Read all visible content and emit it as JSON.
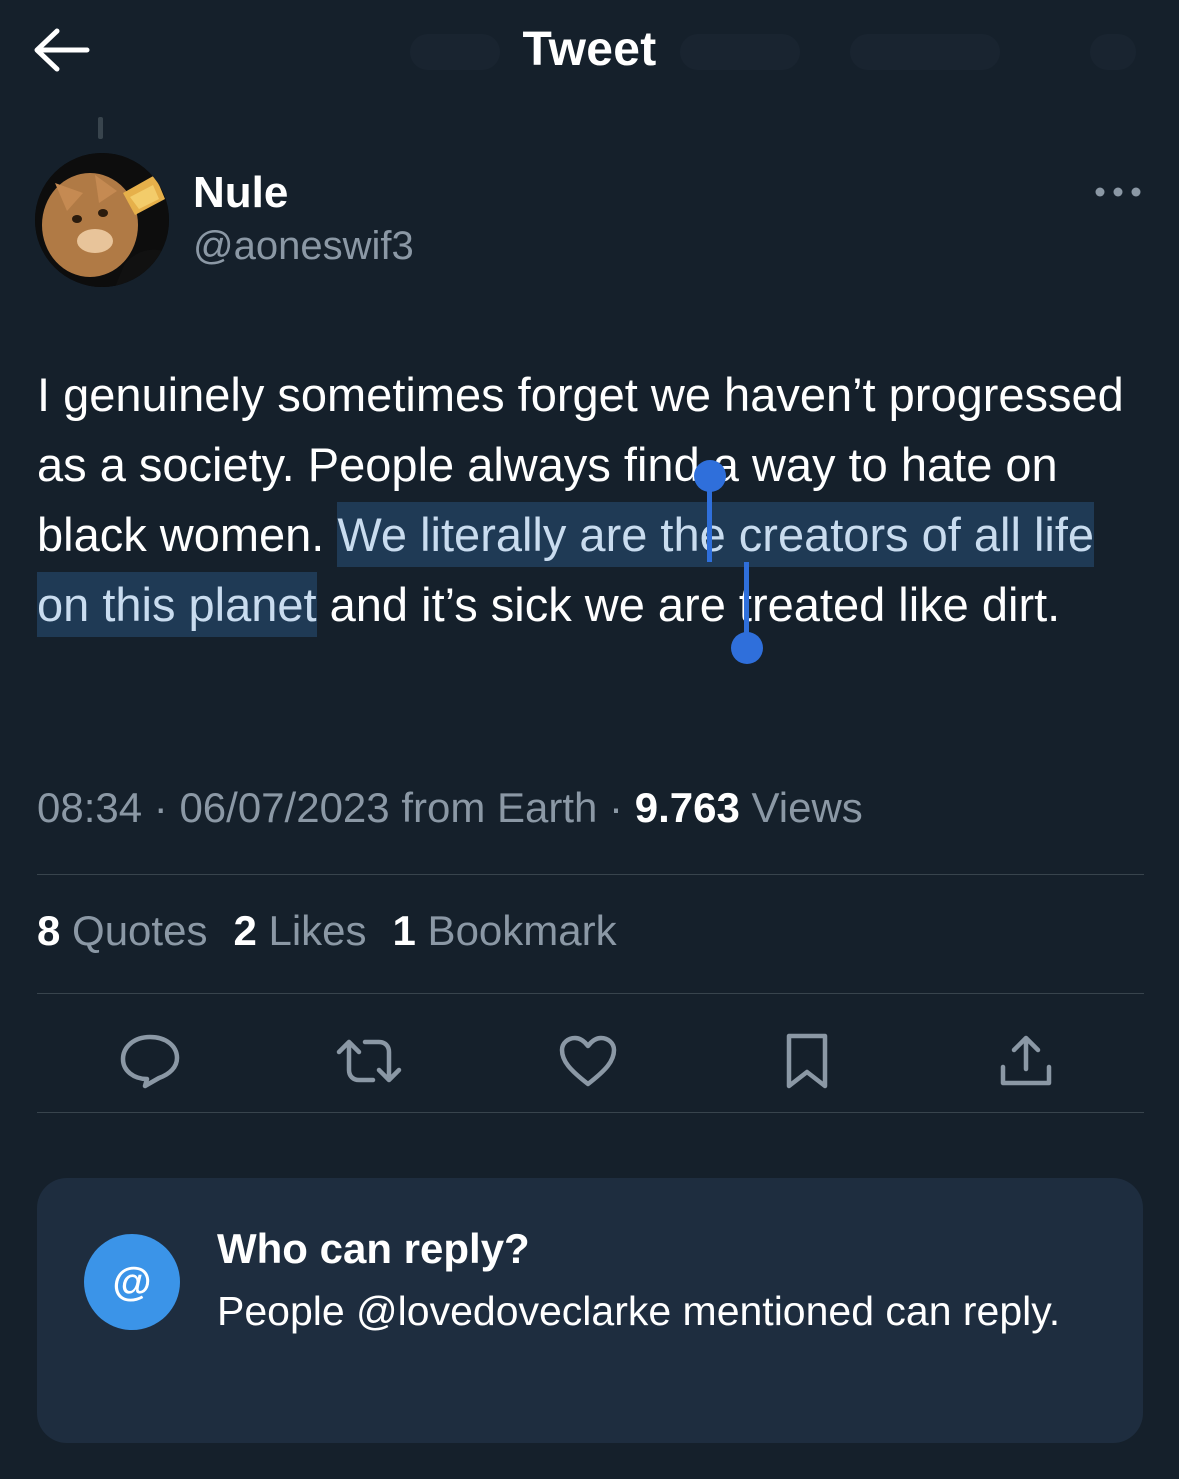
{
  "header": {
    "title": "Tweet"
  },
  "author": {
    "name": "Nule",
    "handle": "@aoneswif3"
  },
  "tweet": {
    "text_before": "I genuinely sometimes forget we haven’t progressed as a society. People always find a way to hate on black women. ",
    "text_selected": "We literally are the creators of all life on this planet",
    "text_after": " and it’s sick we are treated like dirt."
  },
  "meta": {
    "time": "08:34",
    "sep1": " · ",
    "date": "06/07/2023",
    "source": " from Earth",
    "sep2": " · ",
    "views_count": "9.763",
    "views_label": " Views"
  },
  "stats": {
    "quotes_count": "8",
    "quotes_label": " Quotes",
    "likes_count": "2",
    "likes_label": " Likes",
    "bookmarks_count": "1",
    "bookmarks_label": " Bookmark"
  },
  "actions": [
    "reply-icon",
    "retweet-icon",
    "heart-icon",
    "bookmark-icon",
    "share-icon"
  ],
  "reply_restriction": {
    "icon": "@",
    "title": "Who can reply?",
    "body": "People @lovedoveclarke mentioned can reply."
  },
  "colors": {
    "background": "#15202b",
    "secondary_text": "#8b98a5",
    "selection_handle": "#2f6fdb",
    "reply_icon_bg": "#3b94e8",
    "card_bg": "#1e2d3f"
  }
}
